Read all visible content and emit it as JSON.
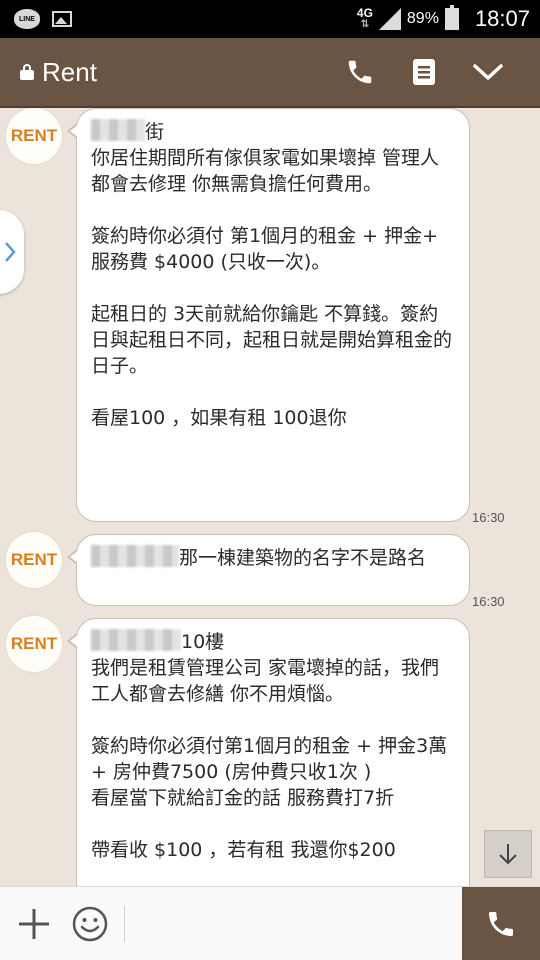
{
  "status_bar": {
    "line_icon_text": "LINE",
    "network_type": "4G",
    "network_arrows": "⇅",
    "battery_percent": "89%",
    "time": "18:07"
  },
  "header": {
    "title": "Rent",
    "icons": [
      "lock-icon",
      "phone-icon",
      "notes-icon",
      "chevron-down-icon"
    ]
  },
  "colors": {
    "header_bg": "#6a5443",
    "chat_bg": "#ece4db",
    "avatar_text": "#d97f1f",
    "bubble_border": "#c9bfb3"
  },
  "messages": [
    {
      "sender_avatar_text": "RENT",
      "first_line_suffix": "街",
      "body": "\n你居住期間所有傢俱家電如果壞掉 管理人都會去修理 你無需負擔任何費用。\n\n簽約時你必須付 第1個月的租金 + 押金+ 服務費 $4000 (只收一次)。\n\n起租日的 3天前就給你鑰匙 不算錢。簽約日與起租日不同，起租日就是開始算租金的日子。\n\n看屋100 ，如果有租 100退你",
      "time": "16:30"
    },
    {
      "sender_avatar_text": "RENT",
      "first_line_suffix": "那一棟建築物的名字不是路名",
      "body": "",
      "time": "16:30"
    },
    {
      "sender_avatar_text": "RENT",
      "first_line_suffix": "10樓",
      "body": "我們是租賃管理公司 家電壞掉的話，我們工人都會去修繕 你不用煩惱。\n\n簽約時你必須付第1個月的租金 + 押金3萬+ 房仲費7500 (房仲費只收1次 )\n看屋當下就給訂金的話 服務費打7折\n\n帶看收 $100 ，若有租 我還你$200",
      "time": ""
    }
  ]
}
